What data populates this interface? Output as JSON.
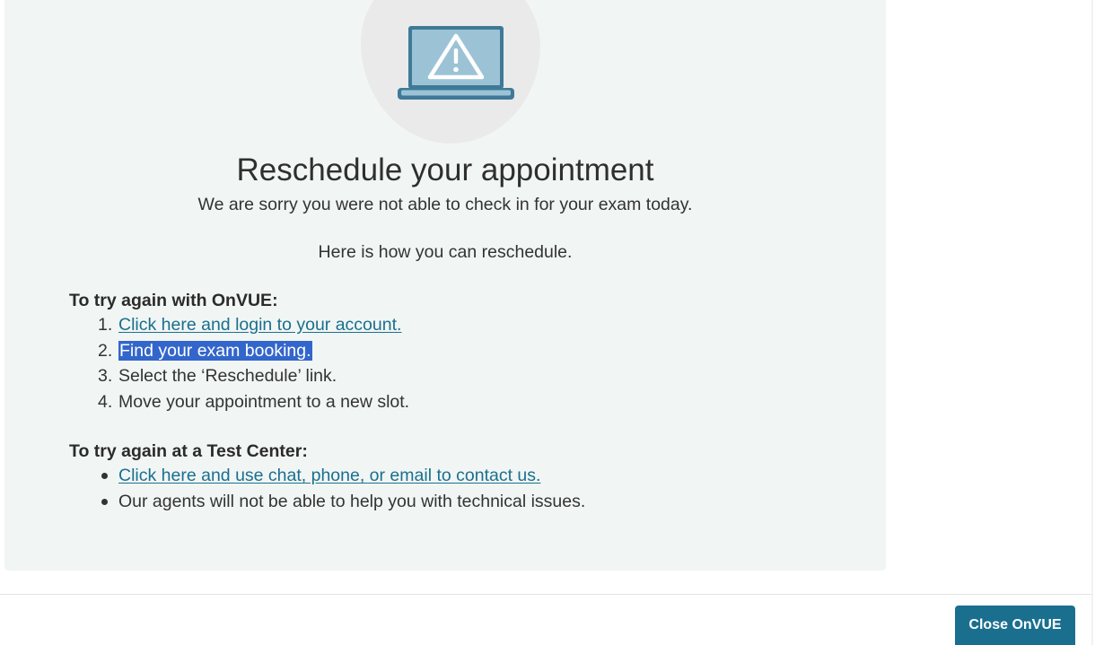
{
  "dialog": {
    "illustration_icon": "laptop-warning-icon",
    "title": "Reschedule your appointment",
    "subtitle": "We are sorry you were not able to check in for your exam today.",
    "how_to": "Here is how you can reschedule."
  },
  "onvue_section": {
    "heading": "To try again with OnVUE:",
    "steps": [
      {
        "num": "1.",
        "text": "Click here and login to your account."
      },
      {
        "num": "2.",
        "text": "Find your exam booking."
      },
      {
        "num": "3.",
        "text": "Select the ‘Reschedule’ link."
      },
      {
        "num": "4.",
        "text": "Move your appointment to a new slot."
      }
    ]
  },
  "test_center_section": {
    "heading": "To try again at a Test Center:",
    "bullets": [
      "Click here and use chat, phone, or email to contact us.",
      "Our agents will not be able to help you with technical issues."
    ]
  },
  "footer": {
    "close_label": "Close OnVUE"
  },
  "colors": {
    "card_background": "#f1f6f4",
    "link": "#1a6f8f",
    "button": "#1a6f8f",
    "selection": "#3366cc",
    "laptop_screen": "#9cc3d5",
    "laptop_frame": "#3e7a97"
  }
}
